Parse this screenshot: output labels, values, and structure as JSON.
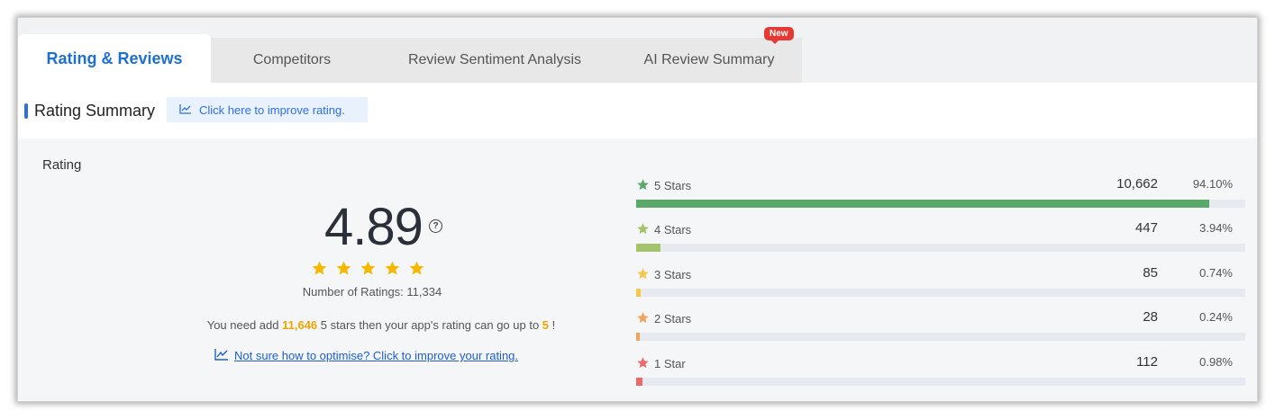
{
  "tabs": [
    {
      "label": "Rating & Reviews"
    },
    {
      "label": "Competitors"
    },
    {
      "label": "Review Sentiment Analysis"
    },
    {
      "label": "AI Review Summary",
      "badge": "New"
    }
  ],
  "summary": {
    "title": "Rating Summary",
    "improve_button": "Click here to improve rating."
  },
  "rating": {
    "section_label": "Rating",
    "score": "4.89",
    "help_icon": "?",
    "number_of_ratings": "Number of Ratings: 11,334",
    "need_prefix": "You need add ",
    "need_count": "11,646",
    "need_middle": " 5 stars then your app's rating can go up to ",
    "need_target": "5",
    "need_suffix": " !",
    "optimise_link": "Not sure how to optimise? Click to improve your rating."
  },
  "distribution": [
    {
      "label": "5 Stars",
      "count": "10,662",
      "percent": "94.10%",
      "fraction": 0.941,
      "color": "#5aa86a"
    },
    {
      "label": "4 Stars",
      "count": "447",
      "percent": "3.94%",
      "fraction": 0.0394,
      "color": "#a3c46a"
    },
    {
      "label": "3 Stars",
      "count": "85",
      "percent": "0.74%",
      "fraction": 0.0074,
      "color": "#f5c84a"
    },
    {
      "label": "2 Stars",
      "count": "28",
      "percent": "0.24%",
      "fraction": 0.0024,
      "color": "#f0a55a"
    },
    {
      "label": "1 Star",
      "count": "112",
      "percent": "0.98%",
      "fraction": 0.0098,
      "color": "#ec6a6a"
    }
  ],
  "colors": {
    "accent": "#1f6fd1",
    "star_gold": "#f5b800",
    "highlight": "#f0a500"
  }
}
